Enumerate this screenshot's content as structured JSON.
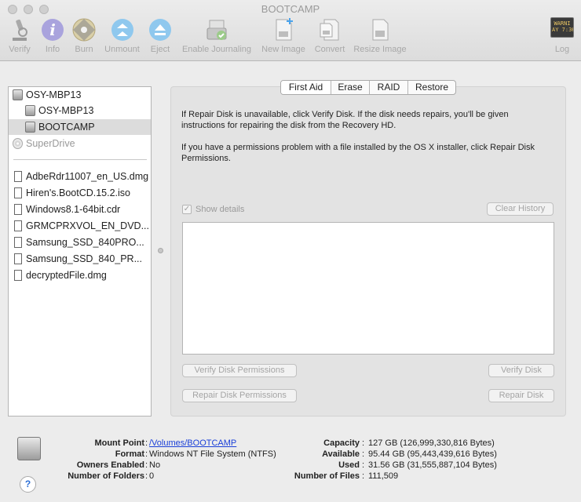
{
  "window": {
    "title": "BOOTCAMP"
  },
  "toolbar": {
    "verify": "Verify",
    "info": "Info",
    "burn": "Burn",
    "unmount": "Unmount",
    "eject": "Eject",
    "enable_journaling": "Enable Journaling",
    "new_image": "New Image",
    "convert": "Convert",
    "resize_image": "Resize Image",
    "log": "Log",
    "log_badge": "WARNI\nAY 7:36"
  },
  "sidebar": {
    "items": [
      {
        "label": "OSY-MBP13",
        "icon": "disk-icon"
      },
      {
        "label": "OSY-MBP13",
        "icon": "volume-icon"
      },
      {
        "label": "BOOTCAMP",
        "icon": "volume-icon"
      },
      {
        "label": "SuperDrive",
        "icon": "superdrive-icon"
      }
    ],
    "files": [
      "AdbeRdr11007_en_US.dmg",
      "Hiren's.BootCD.15.2.iso",
      "Windows8.1-64bit.cdr",
      "GRMCPRXVOL_EN_DVD...",
      "Samsung_SSD_840PRO...",
      "Samsung_SSD_840_PR...",
      "decryptedFile.dmg"
    ]
  },
  "tabs": [
    "First Aid",
    "Erase",
    "RAID",
    "Restore"
  ],
  "first_aid": {
    "para1": "If Repair Disk is unavailable, click Verify Disk. If the disk needs repairs, you'll be given instructions for repairing the disk from the Recovery HD.",
    "para2": "If you have a permissions problem with a file installed by the OS X installer, click Repair Disk Permissions.",
    "show_details": "Show details",
    "clear_history": "Clear History",
    "verify_permissions": "Verify Disk Permissions",
    "verify_disk": "Verify Disk",
    "repair_permissions": "Repair Disk Permissions",
    "repair_disk": "Repair Disk"
  },
  "info": {
    "left": [
      {
        "key": "Mount Point",
        "value": "/Volumes/BOOTCAMP"
      },
      {
        "key": "Format",
        "value": "Windows NT File System (NTFS)"
      },
      {
        "key": "Owners Enabled",
        "value": "No"
      },
      {
        "key": "Number of Folders",
        "value": "0"
      }
    ],
    "right": [
      {
        "key": "Capacity",
        "value": "127 GB (126,999,330,816 Bytes)"
      },
      {
        "key": "Available",
        "value": "95.44 GB (95,443,439,616 Bytes)"
      },
      {
        "key": "Used",
        "value": "31.56 GB (31,555,887,104 Bytes)"
      },
      {
        "key": "Number of Files",
        "value": "111,509"
      }
    ],
    "help": "?"
  }
}
